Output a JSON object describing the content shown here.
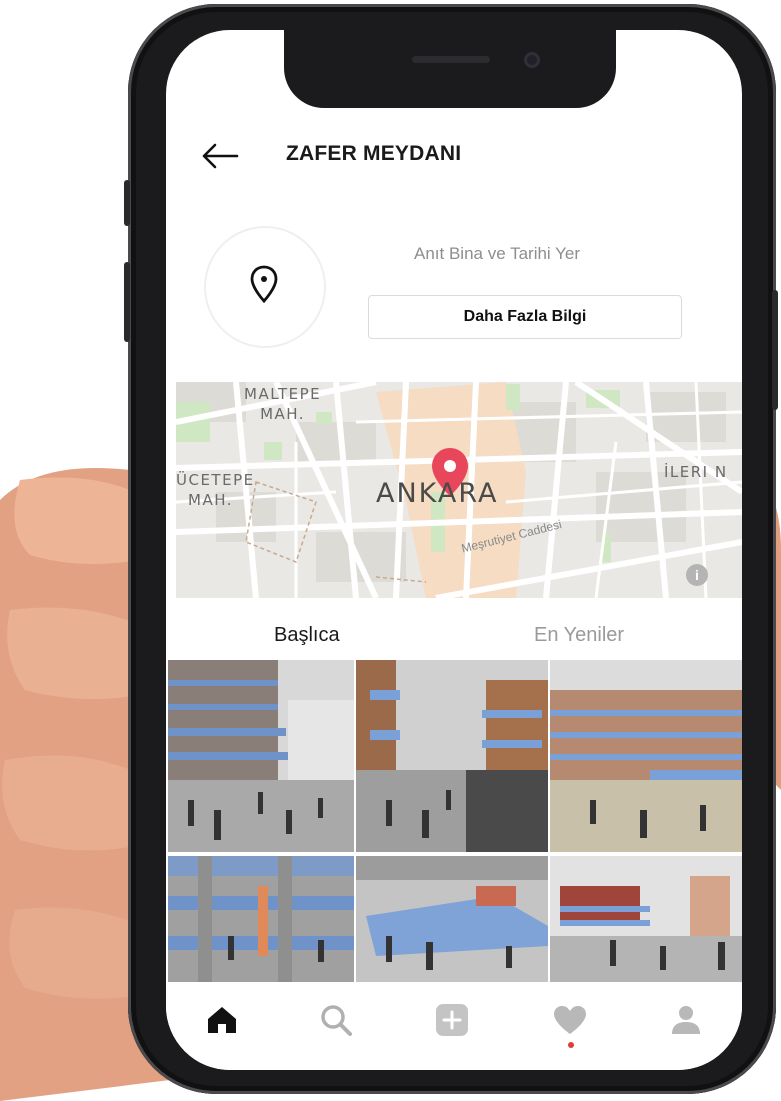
{
  "header": {
    "title": "ZAFER MEYDANI",
    "back_icon": "arrow-left-icon"
  },
  "profile": {
    "category": "Anıt Bina ve Tarihi Yer",
    "more_button": "Daha Fazla Bilgi",
    "avatar_icon": "location-pin-icon"
  },
  "map": {
    "labels": {
      "maltepe_line1": "MALTEPE",
      "maltepe_line2": "MAH.",
      "ucetepe_line1": "ÜCETEPE",
      "ucetepe_line2": "MAH.",
      "ileri": "İLERI N",
      "city": "ANKARA",
      "street": "Meşrutiyet Caddesi"
    },
    "pin_color": "#e8475b",
    "info_icon": "i"
  },
  "tabs": {
    "main": "Başlıca",
    "newest": "En Yeniler"
  },
  "nav": {
    "items": [
      "home-icon",
      "search-icon",
      "add-icon",
      "heart-icon",
      "profile-icon"
    ],
    "notification_color": "#e53a3a"
  }
}
